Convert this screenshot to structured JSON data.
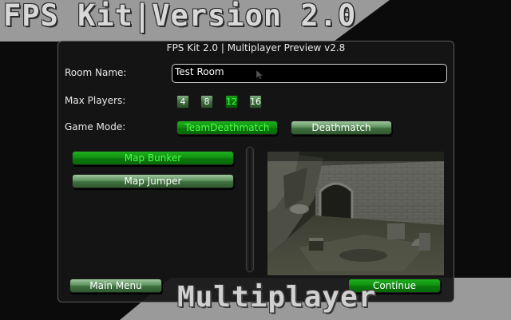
{
  "header": {
    "title": "FPS Kit|Version 2.0"
  },
  "footer": {
    "title": "Multiplayer"
  },
  "window": {
    "title": "FPS Kit 2.0 | Multiplayer Preview v2.8",
    "room_name_label": "Room Name:",
    "room_name_value": "Test Room",
    "max_players_label": "Max Players:",
    "max_players_options": [
      "4",
      "8",
      "12",
      "16"
    ],
    "max_players_selected": "12",
    "game_mode_label": "Game Mode:",
    "game_modes": [
      "TeamDeathmatch",
      "Deathmatch"
    ],
    "game_mode_selected": "TeamDeathmatch",
    "maps": [
      "Map Bunker",
      "Map Jumper"
    ],
    "map_selected": "Map Bunker",
    "main_menu_label": "Main Menu",
    "continue_label": "Continue"
  },
  "colors": {
    "button_normal": "#5f925f",
    "button_active": "#119211",
    "active_text": "#4cff4c",
    "band": "#9a9a9a"
  }
}
